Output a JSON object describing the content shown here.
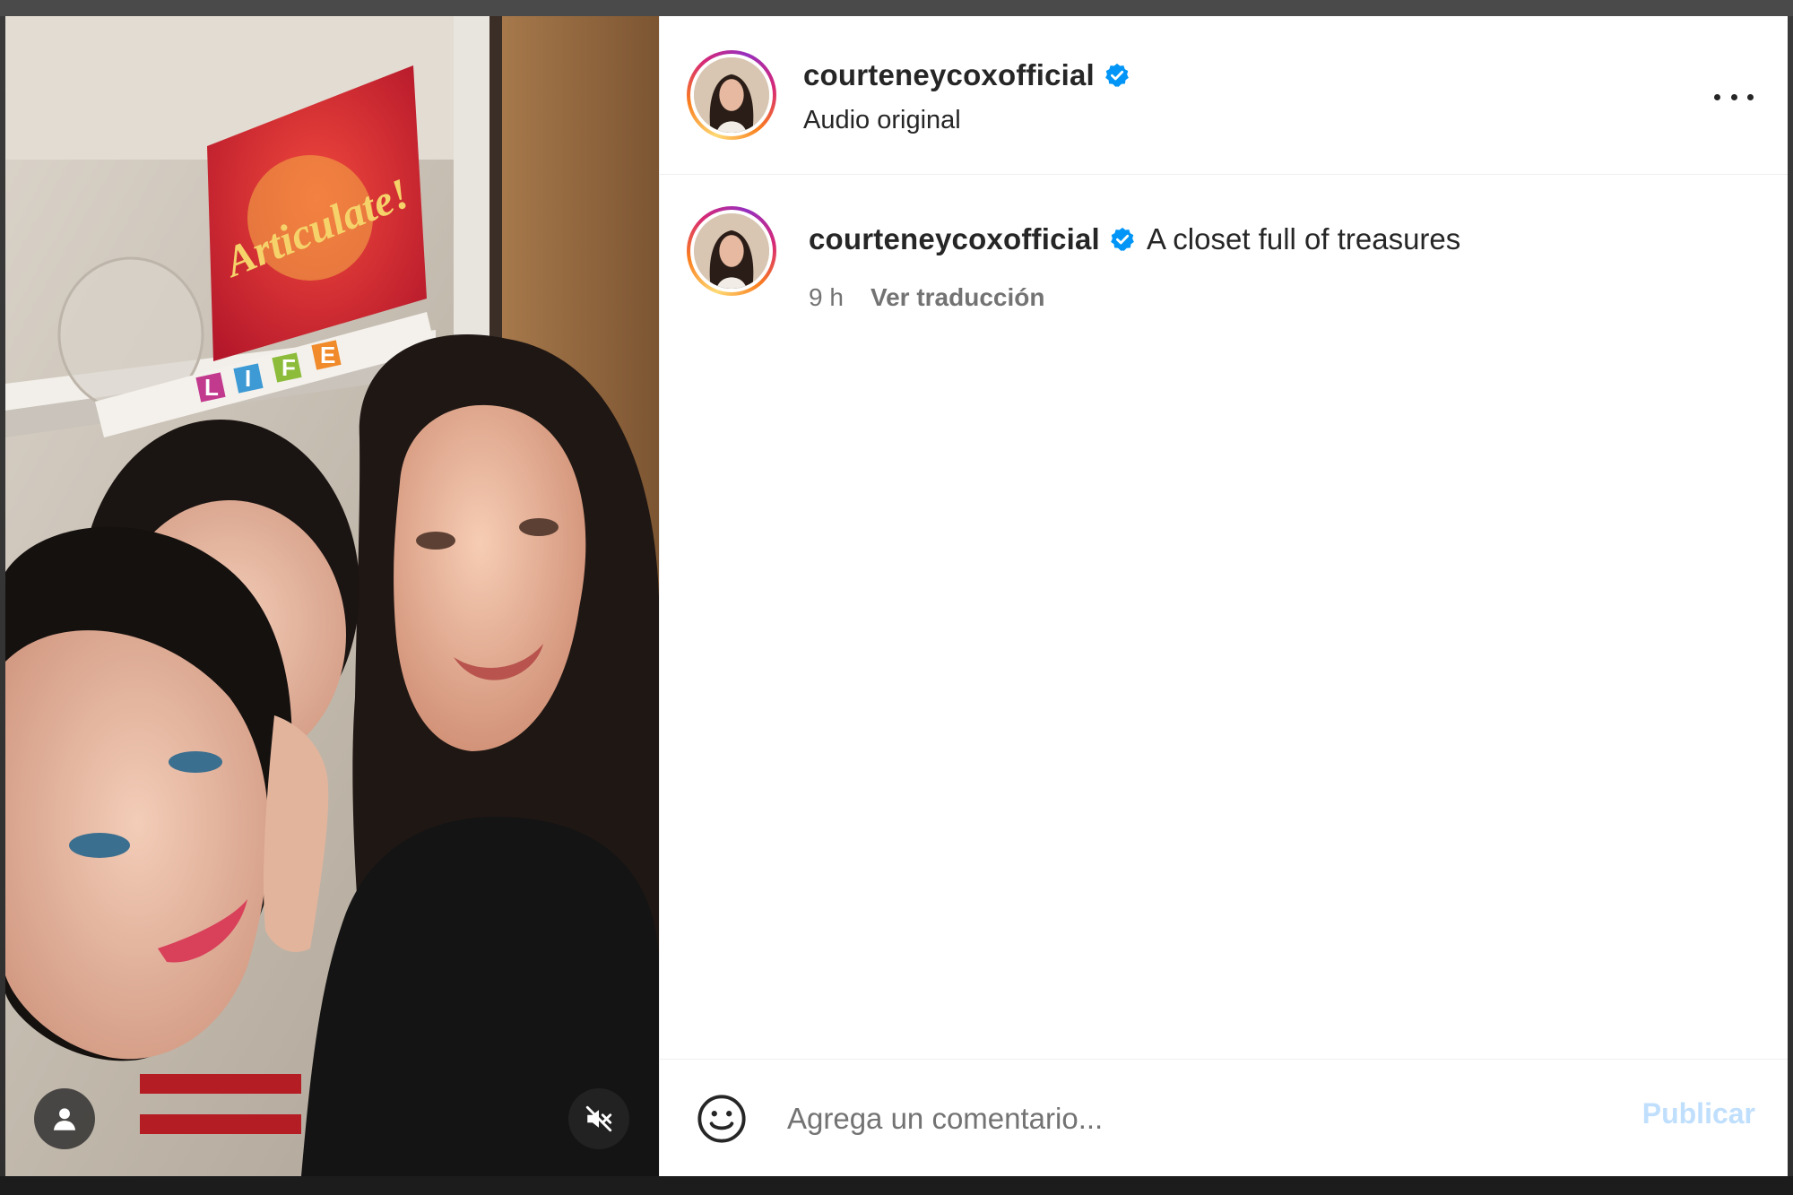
{
  "post": {
    "username": "courteneycoxofficial",
    "verified": true,
    "audio_label": "Audio original"
  },
  "caption": {
    "username": "courteneycoxofficial",
    "text": "A closet full of treasures",
    "time": "9 h",
    "translate_label": "Ver traducción"
  },
  "comment": {
    "placeholder": "Agrega un comentario...",
    "publish_label": "Publicar"
  },
  "media": {
    "game_box_title": "Articulate!",
    "game_box_letters": [
      "L",
      "I",
      "F",
      "E"
    ],
    "mute_icon": "speaker-muted-icon",
    "user_icon": "person-icon"
  },
  "colors": {
    "verified_blue": "#0095f6",
    "publish_disabled": "#c0dffd",
    "text_primary": "#262626",
    "text_secondary": "#737373"
  }
}
